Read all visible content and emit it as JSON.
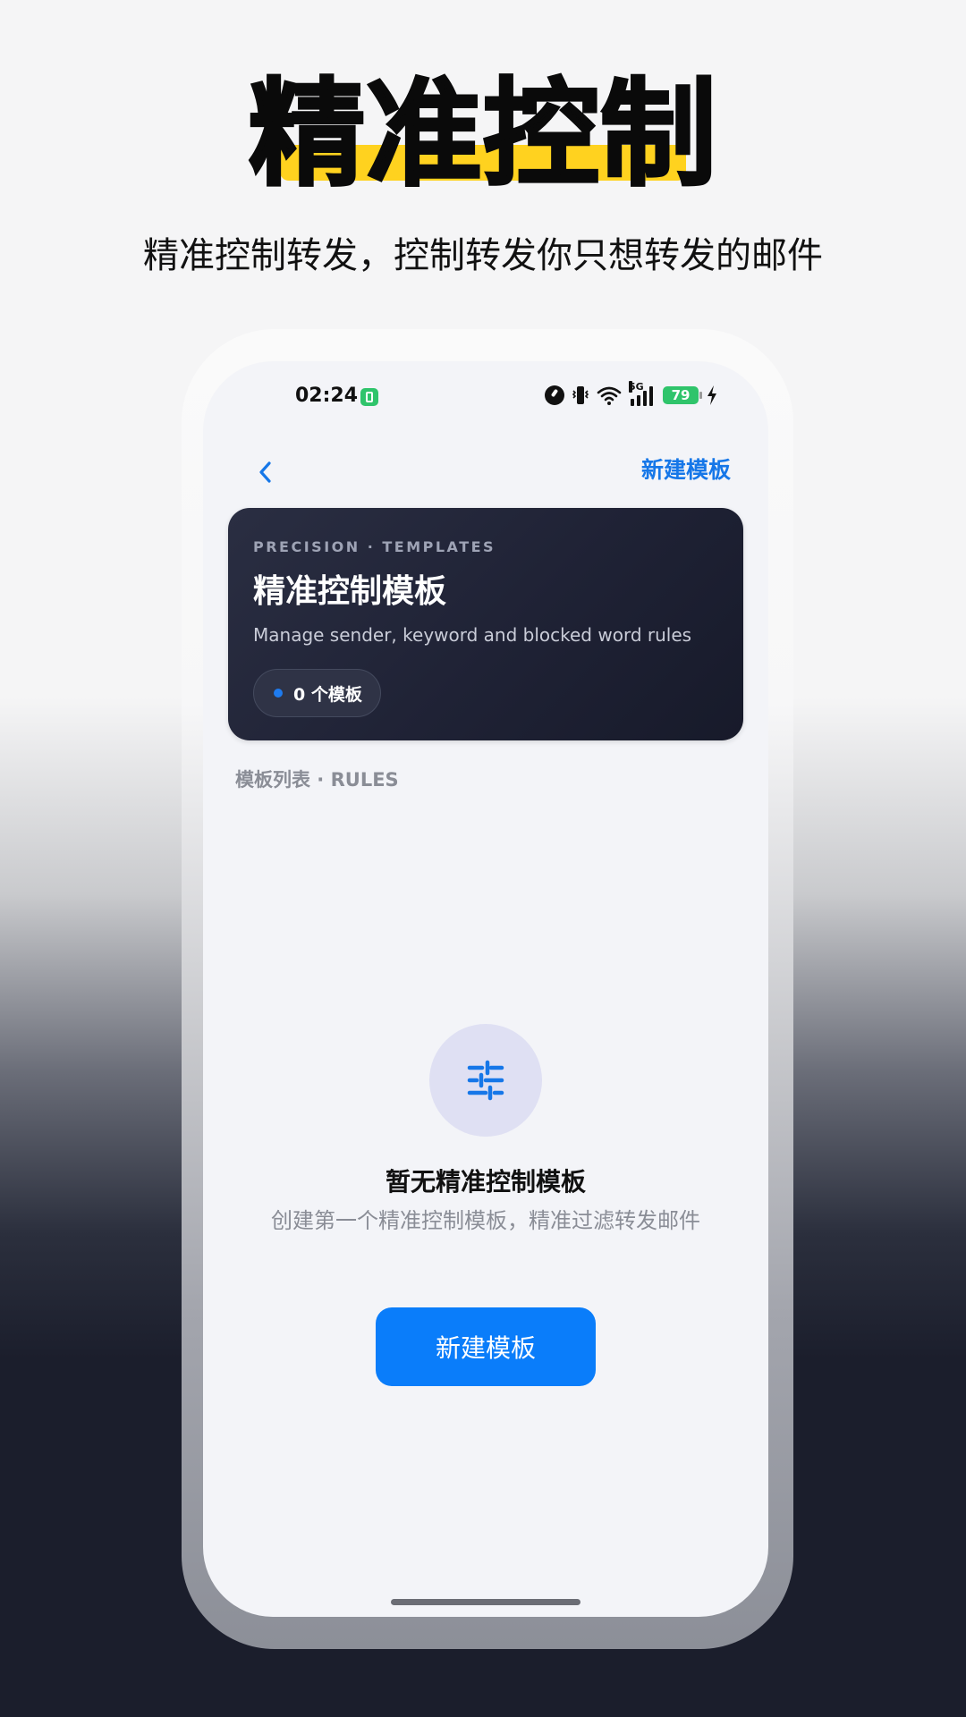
{
  "promo": {
    "headline": "精准控制",
    "subheadline": "精准控制转发，控制转发你只想转发的邮件",
    "accent_color": "#ffd21f"
  },
  "status_bar": {
    "time": "02:24",
    "network": "5G",
    "battery": "79",
    "icons": [
      "notification-icon",
      "data-saver-icon",
      "vibrate-icon",
      "wifi-icon",
      "signal-icon",
      "battery-icon",
      "charging-icon"
    ]
  },
  "nav": {
    "back_icon": "chevron-left-icon",
    "action_label": "新建模板",
    "accent_color": "#1677e8"
  },
  "hero": {
    "eyebrow": "PRECISION · TEMPLATES",
    "title": "精准控制模板",
    "subtitle": "Manage sender, keyword and blocked word rules",
    "count_label": "0 个模板"
  },
  "list": {
    "section_label": "模板列表 · RULES"
  },
  "empty_state": {
    "icon": "sliders-icon",
    "title": "暂无精准控制模板",
    "description": "创建第一个精准控制模板，精准过滤转发邮件",
    "button_label": "新建模板",
    "button_color": "#0a7dfa"
  }
}
